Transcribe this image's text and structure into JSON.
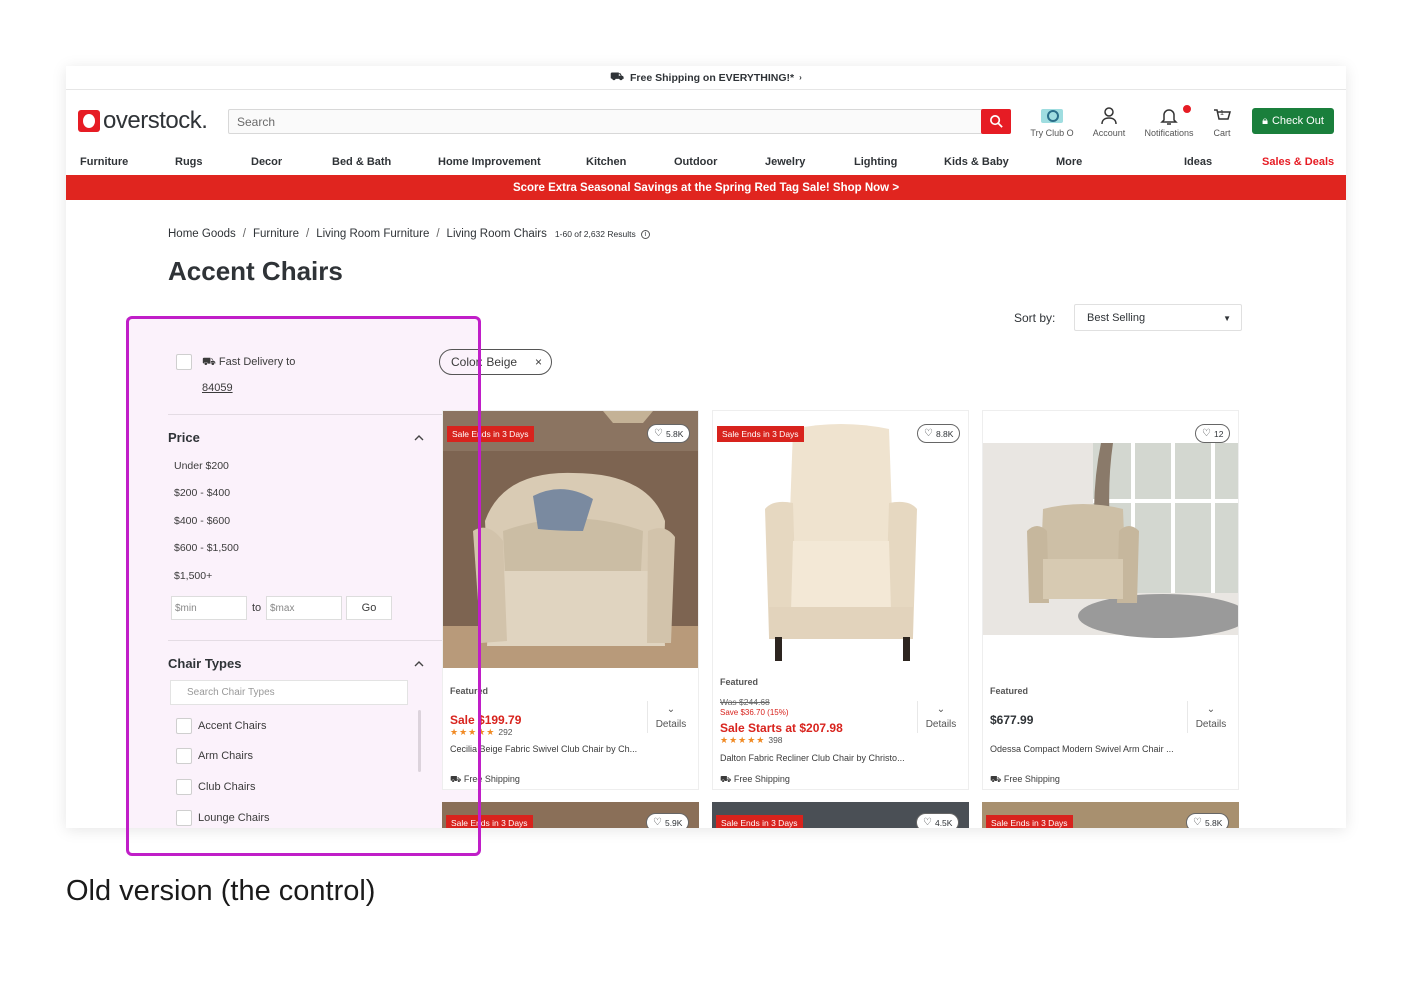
{
  "promo": {
    "text": "Free Shipping on EVERYTHING!*",
    "caret": "›"
  },
  "header": {
    "logo": "overstock.",
    "search_placeholder": "Search",
    "icons": [
      {
        "label": "Try Club O"
      },
      {
        "label": "Account"
      },
      {
        "label": "Notifications"
      },
      {
        "label": "Cart",
        "count": "1"
      }
    ],
    "checkout": "Check Out"
  },
  "nav": [
    "Furniture",
    "Rugs",
    "Decor",
    "Bed & Bath",
    "Home Improvement",
    "Kitchen",
    "Outdoor",
    "Jewelry",
    "Lighting",
    "Kids & Baby",
    "More",
    "Ideas",
    "Sales & Deals"
  ],
  "banner": "Score Extra Seasonal Savings at the Spring Red Tag Sale! Shop Now >",
  "breadcrumb": {
    "items": [
      "Home Goods",
      "Furniture",
      "Living Room Furniture",
      "Living Room Chairs"
    ],
    "results": "1-60 of 2,632 Results"
  },
  "page_title": "Accent Chairs",
  "sort": {
    "label": "Sort by:",
    "value": "Best Selling"
  },
  "filters": {
    "fast_delivery": "Fast Delivery to",
    "zip": "84059",
    "price": {
      "title": "Price",
      "options": [
        "Under $200",
        "$200 - $400",
        "$400 - $600",
        "$600 - $1,500",
        "$1,500+"
      ],
      "min_placeholder": "$min",
      "to": "to",
      "max_placeholder": "$max",
      "go": "Go"
    },
    "chair_types": {
      "title": "Chair Types",
      "search_placeholder": "Search Chair Types",
      "options": [
        "Accent Chairs",
        "Arm Chairs",
        "Club Chairs",
        "Lounge Chairs"
      ]
    }
  },
  "chip": {
    "label": "Color: Beige",
    "remove": "×"
  },
  "products": [
    {
      "sale_tag": "Sale Ends in 3 Days",
      "favorites": "5.8K",
      "featured": "Featured",
      "price": "Sale $199.79",
      "reviews": "292",
      "name": "Cecilia Beige Fabric Swivel Club Chair by Ch...",
      "shipping": "Free Shipping",
      "details": "Details"
    },
    {
      "sale_tag": "Sale Ends in 3 Days",
      "favorites": "8.8K",
      "featured": "Featured",
      "was": "Was $244.68",
      "save": "Save $36.70 (15%)",
      "price": "Sale Starts at $207.98",
      "reviews": "398",
      "name": "Dalton Fabric Recliner Club Chair by Christo...",
      "shipping": "Free Shipping",
      "details": "Details"
    },
    {
      "favorites": "12",
      "featured": "Featured",
      "price": "$677.99",
      "name": "Odessa Compact Modern Swivel Arm Chair ...",
      "shipping": "Free Shipping",
      "details": "Details"
    }
  ],
  "next_row": [
    {
      "sale_tag": "Sale Ends in 3 Days",
      "favorites": "5.9K"
    },
    {
      "sale_tag": "Sale Ends in 3 Days",
      "favorites": "4.5K"
    },
    {
      "sale_tag": "Sale Ends in 3 Days",
      "favorites": "5.8K"
    }
  ],
  "caption": "Old version (the control)",
  "colors": {
    "brand_red": "#e61c24",
    "checkout_green": "#1a7f3c",
    "highlight": "#c01ec8",
    "filter_bg": "#fbf2fb"
  }
}
